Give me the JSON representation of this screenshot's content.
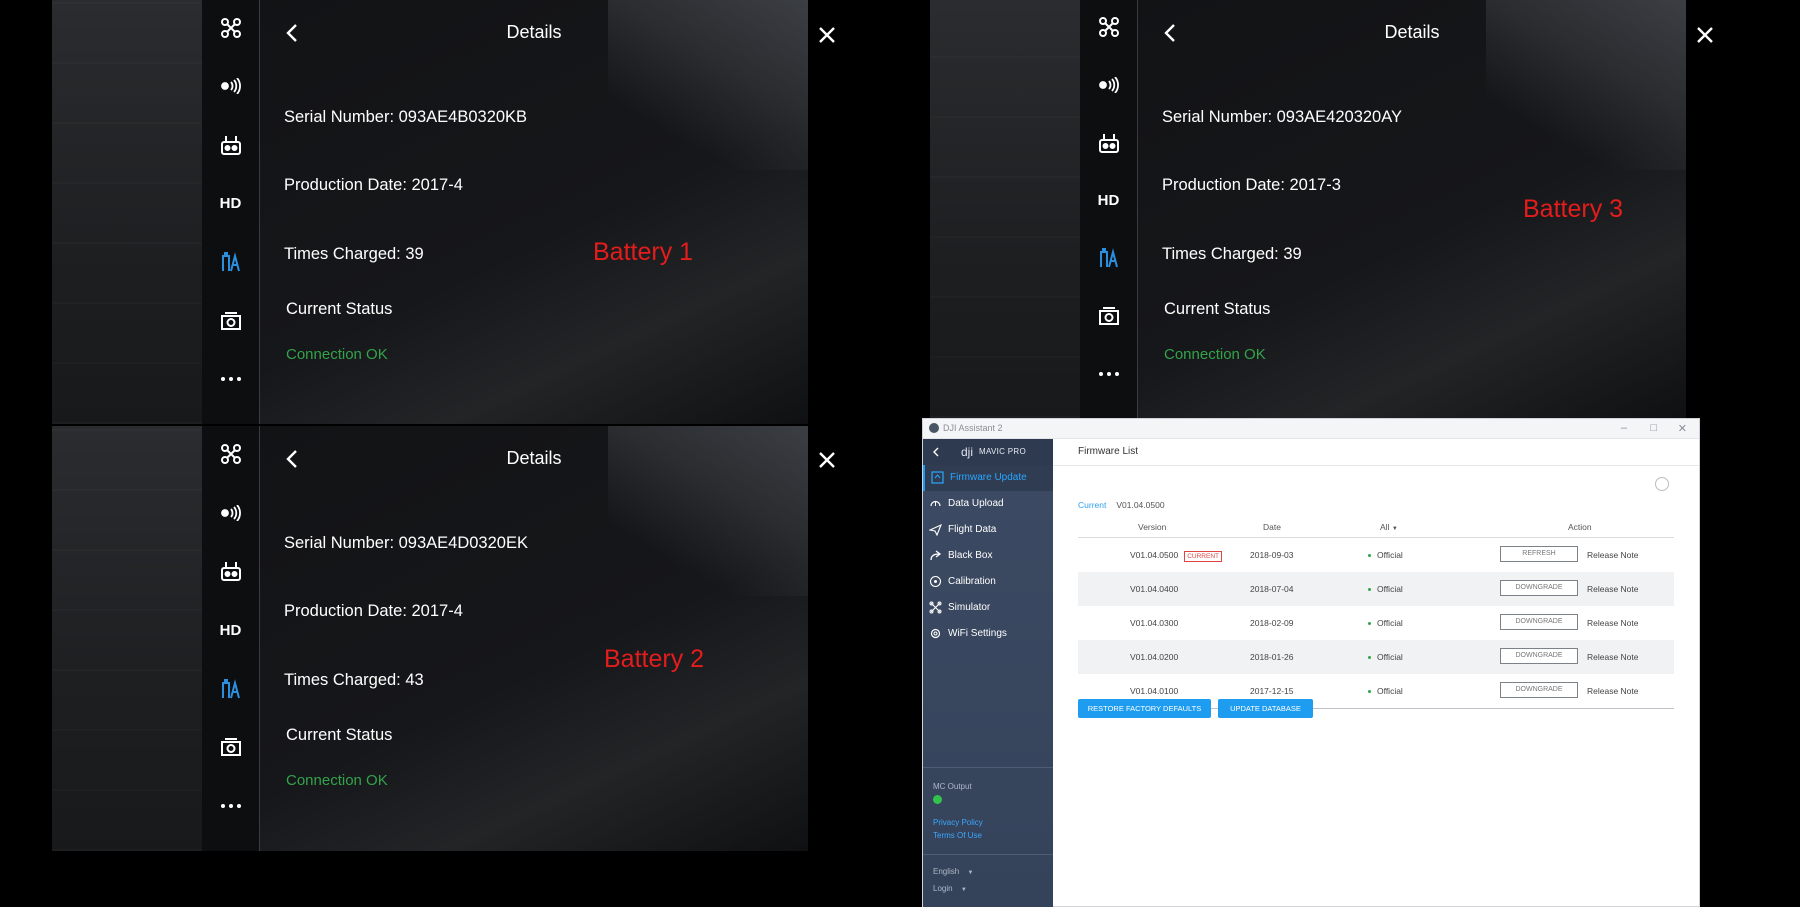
{
  "batteries": [
    {
      "title": "Details",
      "serial": "Serial Number: 093AE4B0320KB",
      "production": "Production Date: 2017-4",
      "charged": "Times Charged: 39",
      "status_heading": "Current Status",
      "status_value": "Connection OK",
      "label": "Battery 1"
    },
    {
      "title": "Details",
      "serial": "Serial Number: 093AE4D0320EK",
      "production": "Production Date: 2017-4",
      "charged": "Times Charged: 43",
      "status_heading": "Current Status",
      "status_value": "Connection OK",
      "label": "Battery 2"
    },
    {
      "title": "Details",
      "serial": "Serial Number: 093AE420320AY",
      "production": "Production Date: 2017-3",
      "charged": "Times Charged: 39",
      "status_heading": "Current Status",
      "status_value": "Connection OK",
      "label": "Battery 3"
    }
  ],
  "rail_icons": [
    "aircraft-icon",
    "signal-icon",
    "remote-controller-icon",
    "HD",
    "battery-icon",
    "camera-icon",
    "more-icon"
  ],
  "rail_hd": "HD",
  "assistant": {
    "window_title": "DJI Assistant 2",
    "product": "MAVIC PRO",
    "brand": "dji",
    "nav": [
      {
        "label": "Firmware Update",
        "icon": "firmware-icon"
      },
      {
        "label": "Data Upload",
        "icon": "upload-icon"
      },
      {
        "label": "Flight Data",
        "icon": "flight-icon"
      },
      {
        "label": "Black Box",
        "icon": "share-icon"
      },
      {
        "label": "Calibration",
        "icon": "calibration-icon"
      },
      {
        "label": "Simulator",
        "icon": "simulator-icon"
      },
      {
        "label": "WiFi Settings",
        "icon": "gear-icon"
      }
    ],
    "mc_output": "MC Output",
    "privacy": "Privacy Policy",
    "terms": "Terms Of Use",
    "language": "English",
    "login": "Login",
    "firmware_list_title": "Firmware List",
    "current_label": "Current",
    "current_version": "V01.04.0500",
    "columns": {
      "version": "Version",
      "date": "Date",
      "filter": "All",
      "action": "Action"
    },
    "rows": [
      {
        "version": "V01.04.0500",
        "tag": "CURRENT",
        "date": "2018-09-03",
        "type": "Official",
        "button": "REFRESH",
        "note": "Release Note"
      },
      {
        "version": "V01.04.0400",
        "tag": "",
        "date": "2018-07-04",
        "type": "Official",
        "button": "DOWNGRADE",
        "note": "Release Note"
      },
      {
        "version": "V01.04.0300",
        "tag": "",
        "date": "2018-02-09",
        "type": "Official",
        "button": "DOWNGRADE",
        "note": "Release Note"
      },
      {
        "version": "V01.04.0200",
        "tag": "",
        "date": "2018-01-26",
        "type": "Official",
        "button": "DOWNGRADE",
        "note": "Release Note"
      },
      {
        "version": "V01.04.0100",
        "tag": "",
        "date": "2017-12-15",
        "type": "Official",
        "button": "DOWNGRADE",
        "note": "Release Note"
      }
    ],
    "restore_button": "RESTORE FACTORY DEFAULTS",
    "update_db_button": "UPDATE DATABASE"
  },
  "colors": {
    "status_green": "#33a34a",
    "label_red": "#e51c1c",
    "accent_blue": "#1e9cf0",
    "rail_blue": "#2b8fe0"
  }
}
